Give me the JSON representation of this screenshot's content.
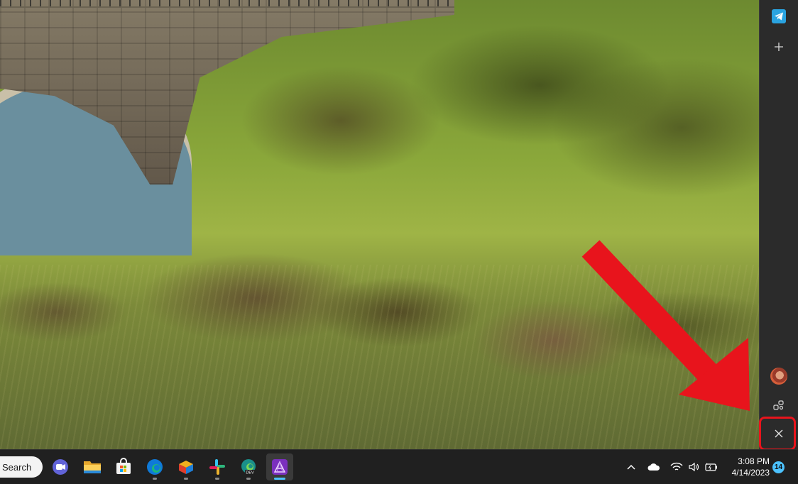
{
  "sidebar": {
    "apps": [
      {
        "name": "telegram",
        "icon": "telegram-icon"
      },
      {
        "name": "add",
        "icon": "plus-icon"
      }
    ],
    "bottom": [
      {
        "name": "profile",
        "icon": "avatar"
      },
      {
        "name": "manage-apps",
        "icon": "apps-settings-icon"
      },
      {
        "name": "close",
        "icon": "close-icon"
      }
    ]
  },
  "annotation": {
    "arrow_color": "#e8141c",
    "highlight_color": "#e8141c"
  },
  "taskbar": {
    "search_label": "Search",
    "apps": [
      {
        "name": "teams",
        "icon": "teams-icon",
        "active": false
      },
      {
        "name": "file-explorer",
        "icon": "folder-icon",
        "active": false
      },
      {
        "name": "microsoft-store",
        "icon": "store-icon",
        "active": false
      },
      {
        "name": "edge",
        "icon": "edge-icon",
        "active": false
      },
      {
        "name": "unknown-app",
        "icon": "cube-icon",
        "active": false
      },
      {
        "name": "slack",
        "icon": "slack-icon",
        "active": false
      },
      {
        "name": "edge-dev",
        "icon": "edge-dev-icon",
        "active": false
      },
      {
        "name": "affinity",
        "icon": "affinity-icon",
        "active": true
      }
    ],
    "edge_dev_tag": "DEV",
    "tray": {
      "icons": [
        "chevron-up-icon",
        "cloud-icon",
        "wifi-icon",
        "volume-icon",
        "battery-icon"
      ],
      "time": "3:08 PM",
      "date": "4/14/2023",
      "notifications": "14"
    }
  },
  "accent_color": "#4cc2ff"
}
